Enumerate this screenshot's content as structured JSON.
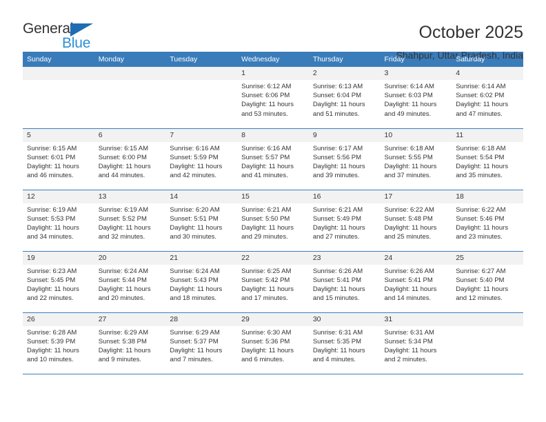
{
  "brand": {
    "name_part1": "General",
    "name_part2": "Blue",
    "accent_color": "#2d8fd5",
    "triangle_color": "#1f6cb4",
    "triangle_icon": "triangle-icon"
  },
  "header": {
    "title": "October 2025",
    "subtitle": "Shahpur, Uttar Pradesh, India"
  },
  "theme": {
    "header_bg": "#3a7cba",
    "header_text": "#ffffff",
    "daynum_bg": "#f2f2f2",
    "cell_bg": "#ffffff",
    "grid_line": "#3a7cba",
    "text": "#333333"
  },
  "weekday_headers": [
    "Sunday",
    "Monday",
    "Tuesday",
    "Wednesday",
    "Thursday",
    "Friday",
    "Saturday"
  ],
  "weeks": [
    [
      {
        "day": "",
        "sunrise": "",
        "sunset": "",
        "daylight1": "",
        "daylight2": ""
      },
      {
        "day": "",
        "sunrise": "",
        "sunset": "",
        "daylight1": "",
        "daylight2": ""
      },
      {
        "day": "",
        "sunrise": "",
        "sunset": "",
        "daylight1": "",
        "daylight2": ""
      },
      {
        "day": "1",
        "sunrise": "Sunrise: 6:12 AM",
        "sunset": "Sunset: 6:06 PM",
        "daylight1": "Daylight: 11 hours",
        "daylight2": "and 53 minutes."
      },
      {
        "day": "2",
        "sunrise": "Sunrise: 6:13 AM",
        "sunset": "Sunset: 6:04 PM",
        "daylight1": "Daylight: 11 hours",
        "daylight2": "and 51 minutes."
      },
      {
        "day": "3",
        "sunrise": "Sunrise: 6:14 AM",
        "sunset": "Sunset: 6:03 PM",
        "daylight1": "Daylight: 11 hours",
        "daylight2": "and 49 minutes."
      },
      {
        "day": "4",
        "sunrise": "Sunrise: 6:14 AM",
        "sunset": "Sunset: 6:02 PM",
        "daylight1": "Daylight: 11 hours",
        "daylight2": "and 47 minutes."
      }
    ],
    [
      {
        "day": "5",
        "sunrise": "Sunrise: 6:15 AM",
        "sunset": "Sunset: 6:01 PM",
        "daylight1": "Daylight: 11 hours",
        "daylight2": "and 46 minutes."
      },
      {
        "day": "6",
        "sunrise": "Sunrise: 6:15 AM",
        "sunset": "Sunset: 6:00 PM",
        "daylight1": "Daylight: 11 hours",
        "daylight2": "and 44 minutes."
      },
      {
        "day": "7",
        "sunrise": "Sunrise: 6:16 AM",
        "sunset": "Sunset: 5:59 PM",
        "daylight1": "Daylight: 11 hours",
        "daylight2": "and 42 minutes."
      },
      {
        "day": "8",
        "sunrise": "Sunrise: 6:16 AM",
        "sunset": "Sunset: 5:57 PM",
        "daylight1": "Daylight: 11 hours",
        "daylight2": "and 41 minutes."
      },
      {
        "day": "9",
        "sunrise": "Sunrise: 6:17 AM",
        "sunset": "Sunset: 5:56 PM",
        "daylight1": "Daylight: 11 hours",
        "daylight2": "and 39 minutes."
      },
      {
        "day": "10",
        "sunrise": "Sunrise: 6:18 AM",
        "sunset": "Sunset: 5:55 PM",
        "daylight1": "Daylight: 11 hours",
        "daylight2": "and 37 minutes."
      },
      {
        "day": "11",
        "sunrise": "Sunrise: 6:18 AM",
        "sunset": "Sunset: 5:54 PM",
        "daylight1": "Daylight: 11 hours",
        "daylight2": "and 35 minutes."
      }
    ],
    [
      {
        "day": "12",
        "sunrise": "Sunrise: 6:19 AM",
        "sunset": "Sunset: 5:53 PM",
        "daylight1": "Daylight: 11 hours",
        "daylight2": "and 34 minutes."
      },
      {
        "day": "13",
        "sunrise": "Sunrise: 6:19 AM",
        "sunset": "Sunset: 5:52 PM",
        "daylight1": "Daylight: 11 hours",
        "daylight2": "and 32 minutes."
      },
      {
        "day": "14",
        "sunrise": "Sunrise: 6:20 AM",
        "sunset": "Sunset: 5:51 PM",
        "daylight1": "Daylight: 11 hours",
        "daylight2": "and 30 minutes."
      },
      {
        "day": "15",
        "sunrise": "Sunrise: 6:21 AM",
        "sunset": "Sunset: 5:50 PM",
        "daylight1": "Daylight: 11 hours",
        "daylight2": "and 29 minutes."
      },
      {
        "day": "16",
        "sunrise": "Sunrise: 6:21 AM",
        "sunset": "Sunset: 5:49 PM",
        "daylight1": "Daylight: 11 hours",
        "daylight2": "and 27 minutes."
      },
      {
        "day": "17",
        "sunrise": "Sunrise: 6:22 AM",
        "sunset": "Sunset: 5:48 PM",
        "daylight1": "Daylight: 11 hours",
        "daylight2": "and 25 minutes."
      },
      {
        "day": "18",
        "sunrise": "Sunrise: 6:22 AM",
        "sunset": "Sunset: 5:46 PM",
        "daylight1": "Daylight: 11 hours",
        "daylight2": "and 23 minutes."
      }
    ],
    [
      {
        "day": "19",
        "sunrise": "Sunrise: 6:23 AM",
        "sunset": "Sunset: 5:45 PM",
        "daylight1": "Daylight: 11 hours",
        "daylight2": "and 22 minutes."
      },
      {
        "day": "20",
        "sunrise": "Sunrise: 6:24 AM",
        "sunset": "Sunset: 5:44 PM",
        "daylight1": "Daylight: 11 hours",
        "daylight2": "and 20 minutes."
      },
      {
        "day": "21",
        "sunrise": "Sunrise: 6:24 AM",
        "sunset": "Sunset: 5:43 PM",
        "daylight1": "Daylight: 11 hours",
        "daylight2": "and 18 minutes."
      },
      {
        "day": "22",
        "sunrise": "Sunrise: 6:25 AM",
        "sunset": "Sunset: 5:42 PM",
        "daylight1": "Daylight: 11 hours",
        "daylight2": "and 17 minutes."
      },
      {
        "day": "23",
        "sunrise": "Sunrise: 6:26 AM",
        "sunset": "Sunset: 5:41 PM",
        "daylight1": "Daylight: 11 hours",
        "daylight2": "and 15 minutes."
      },
      {
        "day": "24",
        "sunrise": "Sunrise: 6:26 AM",
        "sunset": "Sunset: 5:41 PM",
        "daylight1": "Daylight: 11 hours",
        "daylight2": "and 14 minutes."
      },
      {
        "day": "25",
        "sunrise": "Sunrise: 6:27 AM",
        "sunset": "Sunset: 5:40 PM",
        "daylight1": "Daylight: 11 hours",
        "daylight2": "and 12 minutes."
      }
    ],
    [
      {
        "day": "26",
        "sunrise": "Sunrise: 6:28 AM",
        "sunset": "Sunset: 5:39 PM",
        "daylight1": "Daylight: 11 hours",
        "daylight2": "and 10 minutes."
      },
      {
        "day": "27",
        "sunrise": "Sunrise: 6:29 AM",
        "sunset": "Sunset: 5:38 PM",
        "daylight1": "Daylight: 11 hours",
        "daylight2": "and 9 minutes."
      },
      {
        "day": "28",
        "sunrise": "Sunrise: 6:29 AM",
        "sunset": "Sunset: 5:37 PM",
        "daylight1": "Daylight: 11 hours",
        "daylight2": "and 7 minutes."
      },
      {
        "day": "29",
        "sunrise": "Sunrise: 6:30 AM",
        "sunset": "Sunset: 5:36 PM",
        "daylight1": "Daylight: 11 hours",
        "daylight2": "and 6 minutes."
      },
      {
        "day": "30",
        "sunrise": "Sunrise: 6:31 AM",
        "sunset": "Sunset: 5:35 PM",
        "daylight1": "Daylight: 11 hours",
        "daylight2": "and 4 minutes."
      },
      {
        "day": "31",
        "sunrise": "Sunrise: 6:31 AM",
        "sunset": "Sunset: 5:34 PM",
        "daylight1": "Daylight: 11 hours",
        "daylight2": "and 2 minutes."
      },
      {
        "day": "",
        "sunrise": "",
        "sunset": "",
        "daylight1": "",
        "daylight2": ""
      }
    ]
  ]
}
